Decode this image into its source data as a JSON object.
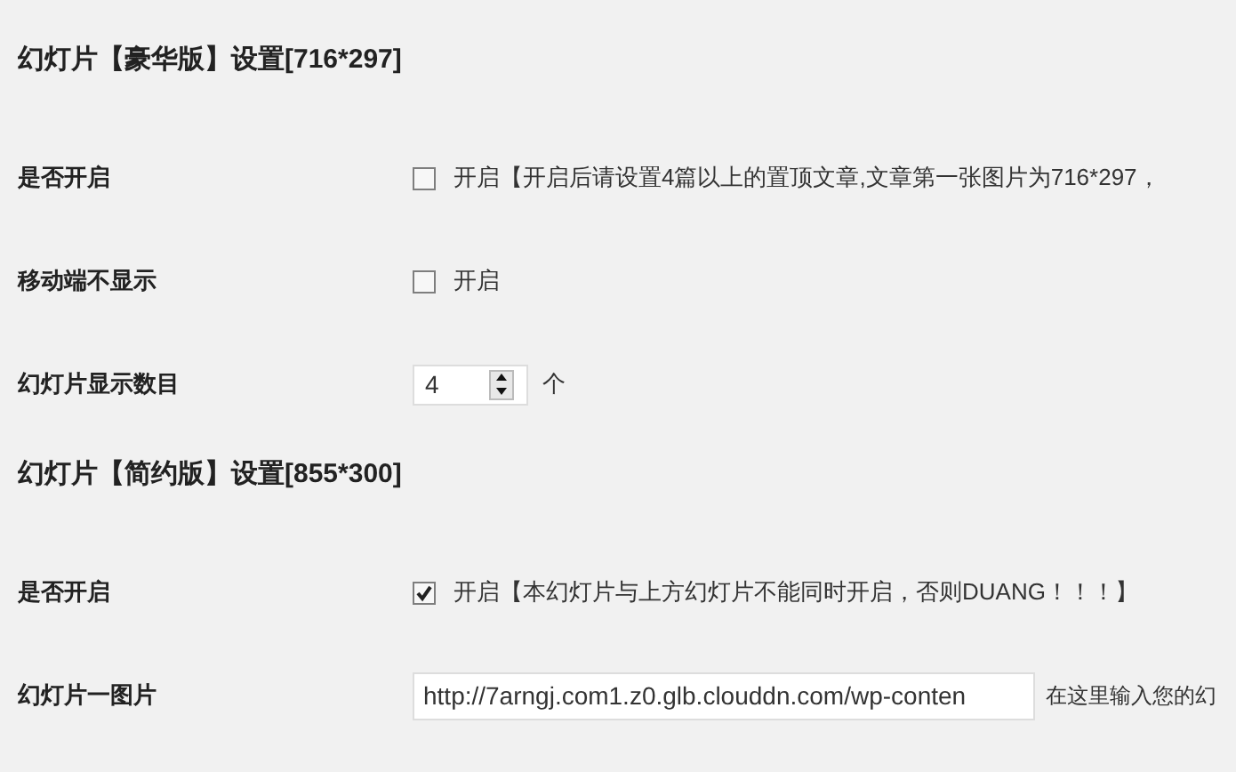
{
  "sections": [
    {
      "title": "幻灯片【豪华版】设置[716*297]",
      "rows": [
        {
          "kind": "checkbox",
          "label": "是否开启",
          "checked": false,
          "text": "开启【开启后请设置4篇以上的置顶文章,文章第一张图片为716*297，"
        },
        {
          "kind": "checkbox",
          "label": "移动端不显示",
          "checked": false,
          "text": "开启"
        },
        {
          "kind": "number",
          "label": "幻灯片显示数目",
          "value": "4",
          "unit": "个"
        }
      ]
    },
    {
      "title": "幻灯片【简约版】设置[855*300]",
      "rows": [
        {
          "kind": "checkbox",
          "label": "是否开启",
          "checked": true,
          "text": "开启【本幻灯片与上方幻灯片不能同时开启，否则DUANG！！！】"
        },
        {
          "kind": "text",
          "label": "幻灯片一图片",
          "value": "http://7arngj.com1.z0.glb.clouddn.com/wp-conten",
          "hint": "在这里输入您的幻"
        }
      ]
    }
  ]
}
